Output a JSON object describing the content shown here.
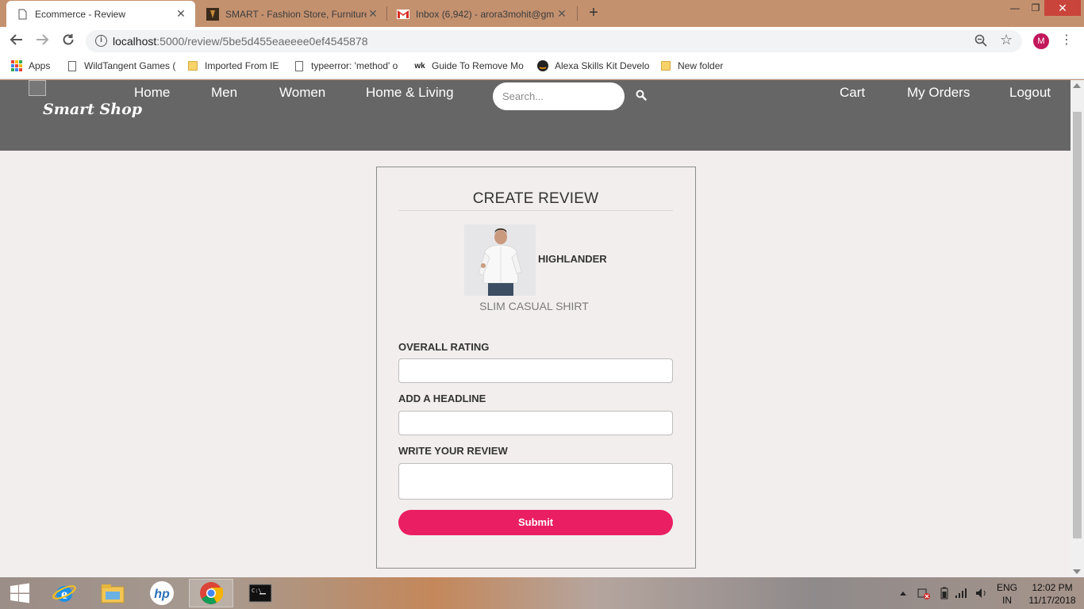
{
  "browser": {
    "tabs": [
      {
        "title": "Ecommerce - Review",
        "active": true
      },
      {
        "title": "SMART - Fashion Store, Furniture",
        "active": false
      },
      {
        "title": "Inbox (6,942) - arora3mohit@gm",
        "active": false
      }
    ],
    "url_host": "localhost",
    "url_rest": ":5000/review/5be5d455eaeeee0ef4545878",
    "profile_initial": "M",
    "bookmarks": [
      "Apps",
      "WildTangent Games (",
      "Imported From IE",
      "typeerror: 'method' o",
      "Guide To Remove Mo",
      "Alexa Skills Kit Develo",
      "New folder"
    ],
    "bookmark_wk_icon": "wk"
  },
  "site": {
    "logo": "Smart Shop",
    "nav_left": [
      "Home",
      "Men",
      "Women",
      "Home & Living"
    ],
    "search_placeholder": "Search...",
    "nav_right": [
      "Cart",
      "My Orders",
      "Logout"
    ]
  },
  "review": {
    "title": "CREATE REVIEW",
    "brand": "HIGHLANDER",
    "product_name": "SLIM CASUAL SHIRT",
    "fields": {
      "rating_label": "OVERALL RATING",
      "rating_value": "",
      "headline_label": "ADD A HEADLINE",
      "headline_value": "",
      "review_label": "WRITE YOUR REVIEW",
      "review_value": ""
    },
    "submit_label": "Submit",
    "accent_color": "#ea1e63"
  },
  "taskbar": {
    "lang_top": "ENG",
    "lang_bottom": "IN",
    "time": "12:02 PM",
    "date": "11/17/2018"
  }
}
